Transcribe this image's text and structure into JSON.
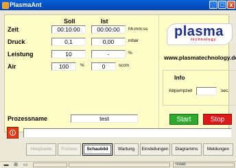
{
  "window": {
    "title": "PlasmaAnt",
    "controls": [
      "_",
      "□",
      "x"
    ]
  },
  "headers": {
    "soll": "Soll",
    "ist": "Ist"
  },
  "rows": [
    {
      "label": "Zeit",
      "soll": "00:10:00",
      "ist": "00:00:00",
      "unit": "hh:mm:ss"
    },
    {
      "label": "Druck",
      "soll": "0,1",
      "ist": "0,00",
      "unit": "mbar"
    },
    {
      "label": "Leistung",
      "soll": "10",
      "ist": "-",
      "unit": "%"
    },
    {
      "label": "Air",
      "soll": "100",
      "soll_unit": "%",
      "ist": "0",
      "unit": "sccm"
    }
  ],
  "logo": {
    "word": "plasma",
    "sub": "technology"
  },
  "url": "www.plasmatechnology.de",
  "info": {
    "title": "Info",
    "label": "Abpumpzeit",
    "value": "",
    "unit": "sec."
  },
  "process": {
    "label": "Prozessname",
    "value": "test"
  },
  "buttons": {
    "start": "Start",
    "stop": "Stop"
  },
  "message": "",
  "tabs": [
    {
      "label": "Hauptseite",
      "state": "disabled"
    },
    {
      "label": "Prozess",
      "state": "disabled"
    },
    {
      "label": "Schaubild",
      "state": "active"
    },
    {
      "label": "Wartung",
      "state": "normal"
    },
    {
      "label": "Einstellungen",
      "state": "normal"
    },
    {
      "label": "Diagramms",
      "state": "normal"
    },
    {
      "label": "Meldungen",
      "state": "normal"
    }
  ],
  "statusbar": {
    "text": "nstab"
  },
  "colors": {
    "panel": "#fffdc8",
    "start": "#2faa2f",
    "stop": "#e01818",
    "titlebar": "#0450c0"
  }
}
